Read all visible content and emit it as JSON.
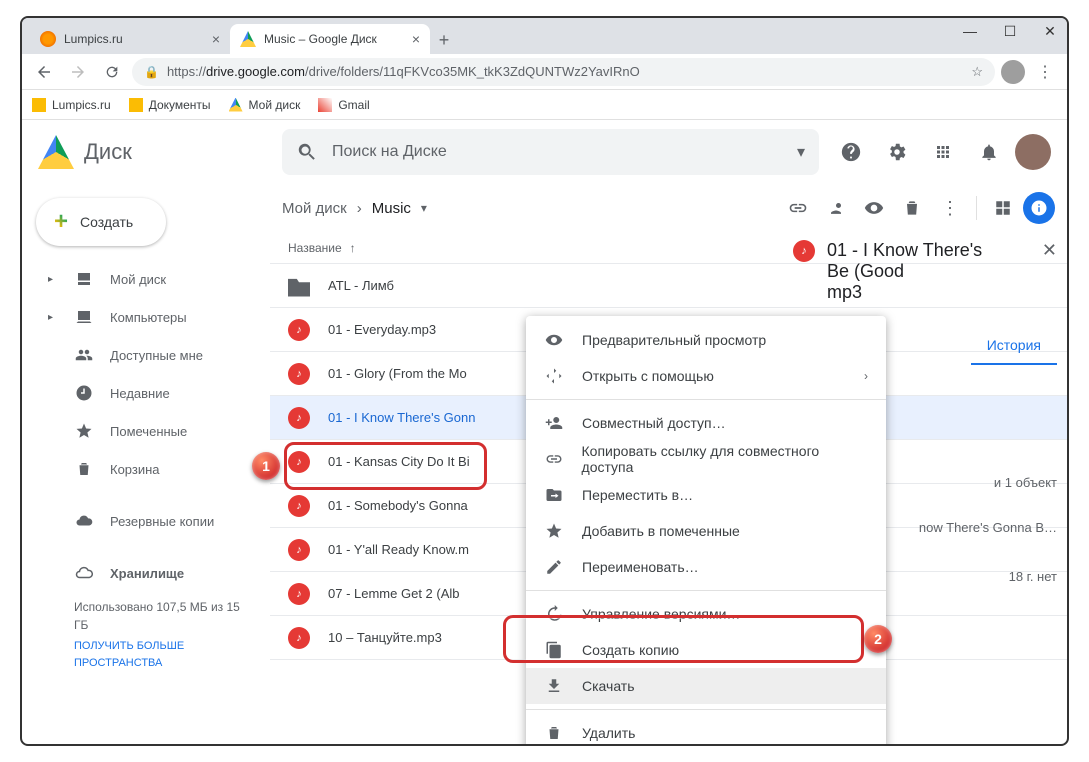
{
  "window": {
    "tabs": [
      {
        "title": "Lumpics.ru"
      },
      {
        "title": "Music – Google Диск"
      }
    ]
  },
  "url": {
    "protocol": "https://",
    "host": "drive.google.com",
    "path": "/drive/folders/11qFKVco35MK_tkK3ZdQUNTWz2YavIRnO"
  },
  "bookmarks": [
    "Lumpics.ru",
    "Документы",
    "Мой диск",
    "Gmail"
  ],
  "drive": {
    "title": "Диск",
    "search_placeholder": "Поиск на Диске"
  },
  "sidebar": {
    "create": "Создать",
    "items": [
      "Мой диск",
      "Компьютеры",
      "Доступные мне",
      "Недавние",
      "Помеченные",
      "Корзина",
      "Резервные копии"
    ],
    "storage_label": "Хранилище",
    "storage_used": "Использовано 107,5 МБ из 15 ГБ",
    "storage_link": "ПОЛУЧИТЬ БОЛЬШЕ ПРОСТРАНСТВА"
  },
  "breadcrumb": {
    "root": "Мой диск",
    "current": "Music"
  },
  "list_header": "Название",
  "files": [
    {
      "type": "folder",
      "name": "ATL - Лимб"
    },
    {
      "type": "audio",
      "name": "01 - Everyday.mp3"
    },
    {
      "type": "audio",
      "name": "01 - Glory (From the Mo"
    },
    {
      "type": "audio",
      "name": "01 - I Know There's Gonn",
      "selected": true
    },
    {
      "type": "audio",
      "name": "01 - Kansas City Do It Bi"
    },
    {
      "type": "audio",
      "name": "01 - Somebody's Gonna"
    },
    {
      "type": "audio",
      "name": "01 - Y'all Ready Know.m"
    },
    {
      "type": "audio",
      "name": "07 - Lemme Get 2 (Alb"
    },
    {
      "type": "audio",
      "name": "10 – Танцуйте.mp3"
    }
  ],
  "context_menu": {
    "preview": "Предварительный просмотр",
    "open_with": "Открыть с помощью",
    "share": "Совместный доступ…",
    "copy_link": "Копировать ссылку для совместного доступа",
    "move_to": "Переместить в…",
    "star": "Добавить в помеченные",
    "rename": "Переименовать…",
    "versions": "Управление версиями…",
    "make_copy": "Создать копию",
    "download": "Скачать",
    "delete": "Удалить"
  },
  "details": {
    "filename_l1": "01 - I Know There's",
    "filename_l2": "Be (Good",
    "filename_l3": "mp3",
    "tab_history": "История",
    "line1": "и 1 объект",
    "line2": "now There's Gonna B…",
    "line3": "18 г. нет"
  },
  "badges": {
    "one": "1",
    "two": "2"
  }
}
